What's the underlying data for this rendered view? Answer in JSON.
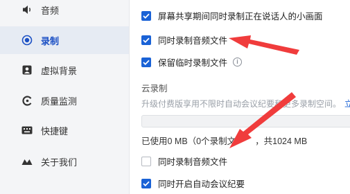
{
  "sidebar": {
    "items": [
      {
        "label": "音频",
        "icon": "speaker-icon"
      },
      {
        "label": "录制",
        "icon": "record-icon",
        "active": true
      },
      {
        "label": "虚拟背景",
        "icon": "person-icon"
      },
      {
        "label": "质量监测",
        "icon": "gauge-icon"
      },
      {
        "label": "快捷键",
        "icon": "keyboard-icon"
      },
      {
        "label": "关于我们",
        "icon": "logo-icon"
      }
    ]
  },
  "local": {
    "screen_share_option": "屏幕共享期间同时录制正在说话人的小画面",
    "record_audio": "同时录制音频文件",
    "keep_temp": "保留临时录制文件"
  },
  "cloud": {
    "title": "云录制",
    "upgrade_text": "升级付费版享用不限时自动会议纪要和更多录制空间。",
    "upgrade_link": "立",
    "usage_prefix": "已使用0 MB（0个录制文",
    "usage_suffix": "，共1024 MB",
    "used_fraction": 0,
    "record_audio": "同时录制音频文件",
    "auto_minutes": "同时开启自动会议纪要"
  },
  "colors": {
    "accent": "#1a62d6",
    "arrow": "#f03c3c"
  }
}
